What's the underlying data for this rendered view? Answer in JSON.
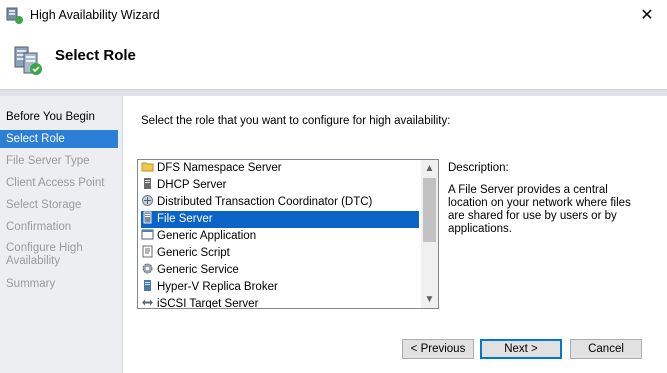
{
  "window": {
    "title": "High Availability Wizard",
    "close_symbol": "✕"
  },
  "header": {
    "title": "Select Role",
    "icon": "cluster-wizard-icon"
  },
  "steps": [
    {
      "label": "Before You Begin",
      "state": "done"
    },
    {
      "label": "Select Role",
      "state": "active"
    },
    {
      "label": "File Server Type",
      "state": "pending"
    },
    {
      "label": "Client Access Point",
      "state": "pending"
    },
    {
      "label": "Select Storage",
      "state": "pending"
    },
    {
      "label": "Confirmation",
      "state": "pending"
    },
    {
      "label": "Configure High Availability",
      "state": "pending"
    },
    {
      "label": "Summary",
      "state": "pending"
    }
  ],
  "main": {
    "prompt": "Select the role that you want to configure for high availability:",
    "roles": [
      {
        "label": "DFS Namespace Server",
        "icon": "folder-icon"
      },
      {
        "label": "DHCP Server",
        "icon": "dhcp-icon"
      },
      {
        "label": "Distributed Transaction Coordinator (DTC)",
        "icon": "dtc-icon"
      },
      {
        "label": "File Server",
        "icon": "file-server-icon",
        "selected": true
      },
      {
        "label": "Generic Application",
        "icon": "application-icon"
      },
      {
        "label": "Generic Script",
        "icon": "script-icon"
      },
      {
        "label": "Generic Service",
        "icon": "gear-icon"
      },
      {
        "label": "Hyper-V Replica Broker",
        "icon": "server-icon"
      },
      {
        "label": "iSCSI Target Server",
        "icon": "iscsi-icon"
      }
    ],
    "description_label": "Description:",
    "description_text": "A File Server provides a central location on your network where files are shared for use by users or by applications."
  },
  "buttons": {
    "previous": "< Previous",
    "next": "Next >",
    "cancel": "Cancel"
  },
  "colors": {
    "accent": "#2b7fd6",
    "selection": "#0a64c8",
    "sidebar_bg": "#eceef1"
  }
}
